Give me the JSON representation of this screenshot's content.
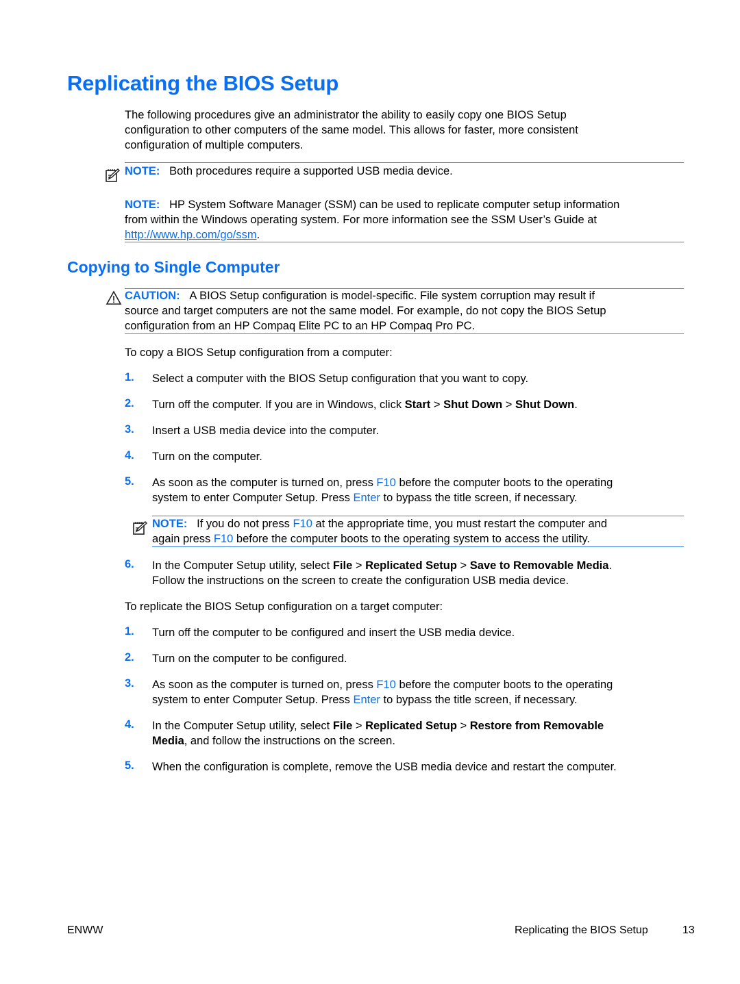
{
  "page": {
    "title": "Replicating the BIOS Setup",
    "intro": "The following procedures give an administrator the ability to easily copy one BIOS Setup configuration to other computers of the same model. This allows for faster, more consistent configuration of multiple computers.",
    "intro_lines": [
      "The following procedures give an administrator the ability to easily copy one BIOS Setup",
      "configuration to other computers of the same model. This allows for faster, more consistent",
      "configuration of multiple computers."
    ],
    "note1": {
      "label": "NOTE:",
      "text": "Both procedures require a supported USB media device.",
      "icon": "note-pencil-icon"
    },
    "note2": {
      "label": "NOTE:",
      "line1": "HP System Software Manager (SSM) can be used to replicate computer setup information",
      "line2": "from within the Windows operating system. For more information see the SSM User’s Guide at",
      "link": "http://www.hp.com/go/ssm",
      "after_link": "."
    },
    "section_title": "Copying to Single Computer",
    "caution": {
      "label": "CAUTION:",
      "icon": "warning-triangle-icon",
      "line1": "A BIOS Setup configuration is model-specific. File system corruption may result if",
      "line2": "source and target computers are not the same model. For example, do not copy the BIOS Setup",
      "line3": "configuration from an HP Compaq Elite PC to an HP Compaq Pro PC."
    },
    "copy_intro": "To copy a BIOS Setup configuration from a computer:",
    "copy_steps": {
      "s1": {
        "num": "1.",
        "text": "Select a computer with the BIOS Setup configuration that you want to copy."
      },
      "s2": {
        "num": "2.",
        "pre": "Turn off the computer. If you are in Windows, click ",
        "b1": "Start",
        "sep1": " > ",
        "b2": "Shut Down",
        "sep2": " > ",
        "b3": "Shut Down",
        "post": "."
      },
      "s3": {
        "num": "3.",
        "text": "Insert a USB media device into the computer."
      },
      "s4": {
        "num": "4.",
        "text": "Turn on the computer."
      },
      "s5": {
        "num": "5.",
        "pre": "As soon as the computer is turned on, press ",
        "key1": "F10",
        "mid": " before the computer boots to the operating",
        "line2_pre": "system to enter Computer Setup. Press ",
        "key2": "Enter",
        "line2_post": " to bypass the title screen, if necessary."
      },
      "note": {
        "label": "NOTE:",
        "pre": "If you do not press ",
        "key1": "F10",
        "mid": " at the appropriate time, you must restart the computer and",
        "line2_pre": "again press ",
        "key2": "F10",
        "line2_post": " before the computer boots to the operating system to access the utility."
      },
      "s6": {
        "num": "6.",
        "pre": "In the Computer Setup utility, select ",
        "b1": "File",
        "sep1": " > ",
        "b2": "Replicated Setup",
        "sep2": " > ",
        "b3": "Save to Removable Media",
        "post": ".",
        "line2": "Follow the instructions on the screen to create the configuration USB media device."
      }
    },
    "replicate_intro": "To replicate the BIOS Setup configuration on a target computer:",
    "replicate_steps": {
      "s1": {
        "num": "1.",
        "text": "Turn off the computer to be configured and insert the USB media device."
      },
      "s2": {
        "num": "2.",
        "text": "Turn on the computer to be configured."
      },
      "s3": {
        "num": "3.",
        "pre": "As soon as the computer is turned on, press ",
        "key1": "F10",
        "mid": " before the computer boots to the operating",
        "line2_pre": "system to enter Computer Setup. Press ",
        "key2": "Enter",
        "line2_post": " to bypass the title screen, if necessary."
      },
      "s4": {
        "num": "4.",
        "pre": "In the Computer Setup utility, select ",
        "b1": "File",
        "sep1": " > ",
        "b2": "Replicated Setup",
        "sep2": " > ",
        "b3": "Restore from Removable",
        "line2_b": "Media",
        "line2_post": ", and follow the instructions on the screen."
      },
      "s5": {
        "num": "5.",
        "text": "When the configuration is complete, remove the USB media device and restart the computer."
      }
    },
    "footer": {
      "left": "ENWW",
      "section": "Replicating the BIOS Setup",
      "page_number": "13"
    }
  },
  "colors": {
    "accent": "#0a6ef0",
    "rule": "#3b82e8",
    "text": "#000000"
  }
}
